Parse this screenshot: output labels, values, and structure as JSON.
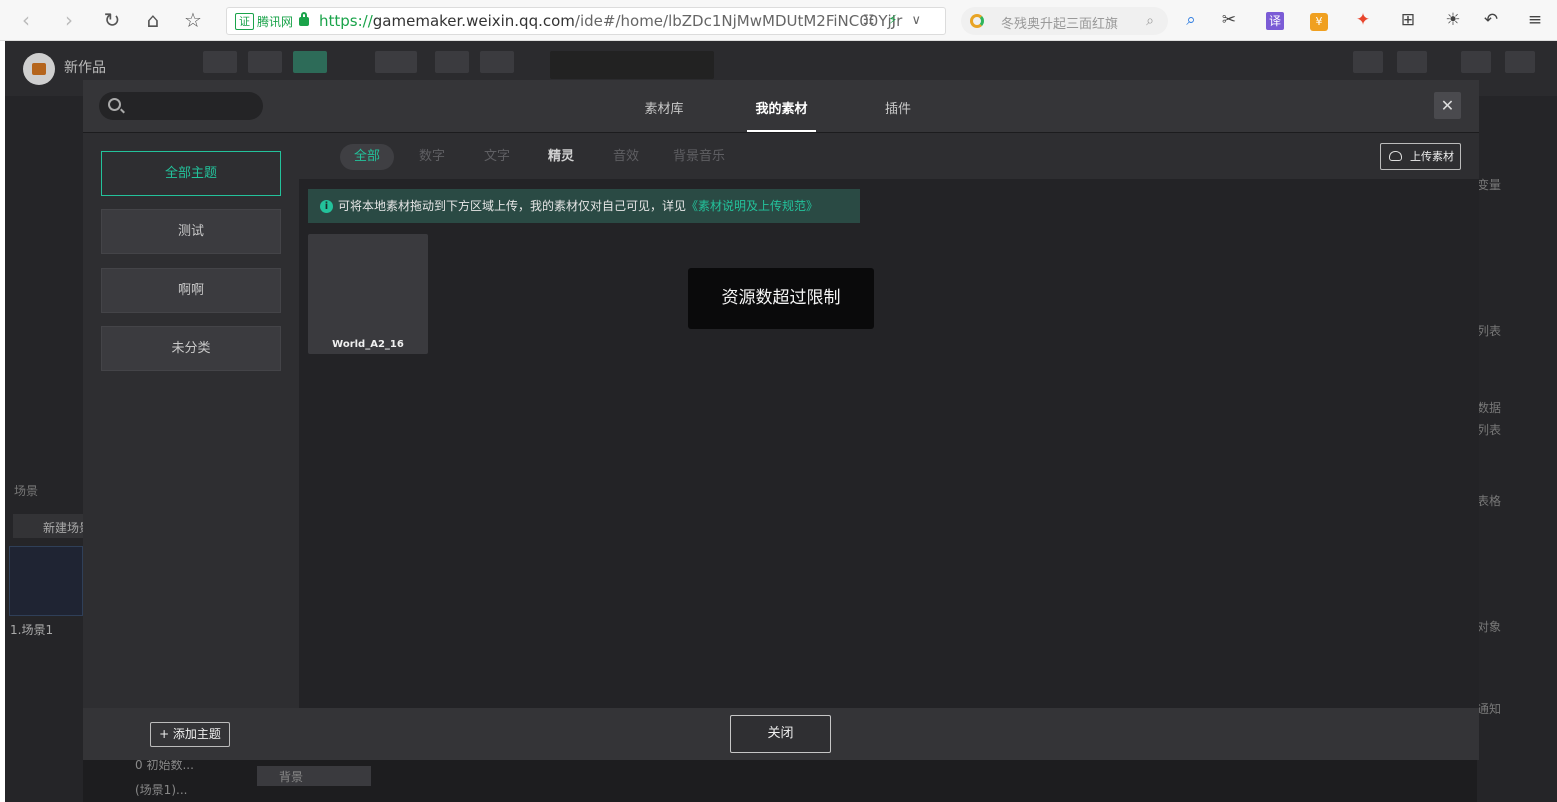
{
  "browser": {
    "back_icon": "chevron-left-icon",
    "forward_icon": "chevron-right-icon",
    "cert_badge": "证",
    "cert_name": "腾讯网",
    "url_protocol": "https://",
    "url_host": "gamemaker.weixin.qq.com",
    "url_path": "/ide#/home/lbZDc1NjMwMDUtM2FiNC00YjJr",
    "search_placeholder": "冬残奥升起三面红旗",
    "translate_label": "译",
    "coin_label": "¥"
  },
  "app": {
    "title": "新作品",
    "scene_panel_label": "场景",
    "new_scene_button": "新建场景",
    "scene_item": "1.场景1",
    "right_labels": [
      "变量",
      "列表",
      "数据",
      "列表",
      "表格",
      "对象",
      "通知"
    ],
    "bottom_labels": [
      "0 初始数...",
      "(场景1)...",
      "背景"
    ]
  },
  "modal": {
    "top_tabs": [
      {
        "label": "素材库",
        "active": false
      },
      {
        "label": "我的素材",
        "active": true
      },
      {
        "label": "插件",
        "active": false
      }
    ],
    "close_icon": "close-icon",
    "categories": [
      {
        "label": "全部主题",
        "active": true
      },
      {
        "label": "测试",
        "active": false
      },
      {
        "label": "啊啊",
        "active": false
      },
      {
        "label": "未分类",
        "active": false
      }
    ],
    "sub_tabs": [
      {
        "label": "全部",
        "state": "active"
      },
      {
        "label": "数字",
        "state": "dim"
      },
      {
        "label": "文字",
        "state": "dim"
      },
      {
        "label": "精灵",
        "state": "bold"
      },
      {
        "label": "音效",
        "state": "dim"
      },
      {
        "label": "背景音乐",
        "state": "dim"
      }
    ],
    "upload_button": "上传素材",
    "notice_text": "可将本地素材拖动到下方区域上传，我的素材仅对自己可见，详见",
    "notice_link": "《素材说明及上传规范》",
    "assets": [
      {
        "name": "World_A2_16"
      }
    ],
    "toast": "资源数超过限制",
    "add_theme_button": "+ 添加主题",
    "close_button": "关闭"
  },
  "colors": {
    "accent": "#23c29b",
    "modal_bg": "#2e2e31",
    "content_bg": "#232326",
    "notice_bg": "#2a4a44"
  }
}
